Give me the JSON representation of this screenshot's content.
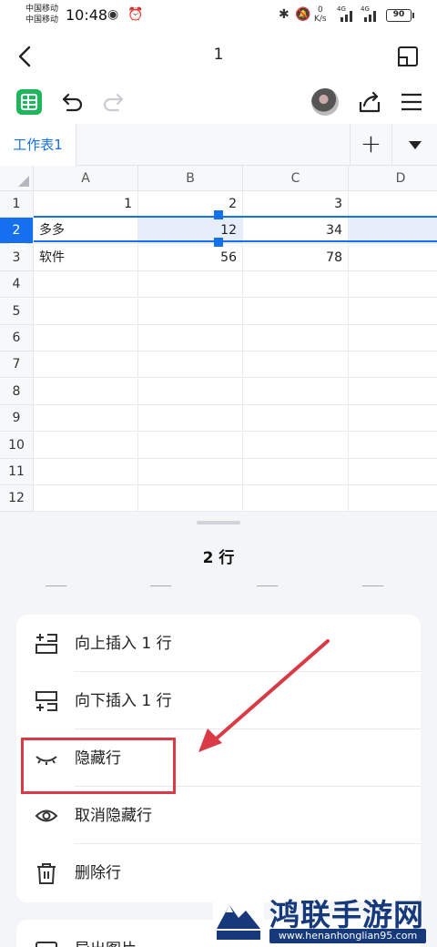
{
  "status_bar": {
    "carrier_line1": "中国移动",
    "carrier_line2": "中国移动",
    "time": "10:48",
    "speed_value": "0",
    "speed_unit": "K/s",
    "signal1_label": "4G",
    "signal2_label": "4G",
    "battery": "90"
  },
  "header": {
    "title": "1"
  },
  "sheet_tabs": {
    "active": "工作表1",
    "add_label": "+"
  },
  "grid": {
    "columns": [
      "A",
      "B",
      "C",
      "D"
    ],
    "rows": [
      {
        "num": "1",
        "cells": [
          "1",
          "2",
          "3",
          ""
        ]
      },
      {
        "num": "2",
        "cells": [
          "多多",
          "12",
          "34",
          ""
        ]
      },
      {
        "num": "3",
        "cells": [
          "软件",
          "56",
          "78",
          ""
        ]
      },
      {
        "num": "4",
        "cells": [
          "",
          "",
          "",
          ""
        ]
      },
      {
        "num": "5",
        "cells": [
          "",
          "",
          "",
          ""
        ]
      },
      {
        "num": "6",
        "cells": [
          "",
          "",
          "",
          ""
        ]
      },
      {
        "num": "7",
        "cells": [
          "",
          "",
          "",
          ""
        ]
      },
      {
        "num": "8",
        "cells": [
          "",
          "",
          "",
          ""
        ]
      },
      {
        "num": "9",
        "cells": [
          "",
          "",
          "",
          ""
        ]
      },
      {
        "num": "10",
        "cells": [
          "",
          "",
          "",
          ""
        ]
      },
      {
        "num": "11",
        "cells": [
          "",
          "",
          "",
          ""
        ]
      },
      {
        "num": "12",
        "cells": [
          "",
          "",
          "",
          ""
        ]
      }
    ],
    "selected_row": "2"
  },
  "panel": {
    "title": "2 行",
    "menu": [
      {
        "label": "向上插入 1 行",
        "icon": "insert-above-icon"
      },
      {
        "label": "向下插入 1 行",
        "icon": "insert-below-icon"
      },
      {
        "label": "隐藏行",
        "icon": "eye-closed-icon"
      },
      {
        "label": "取消隐藏行",
        "icon": "eye-icon"
      },
      {
        "label": "删除行",
        "icon": "trash-icon"
      }
    ],
    "next_group_label": "导出图片"
  },
  "colors": {
    "accent": "#1570ef",
    "sheet_green": "#1fb75b",
    "annotation_red": "#d93a46"
  },
  "watermark": {
    "title": "鸿联手游网",
    "url": "www.henanhonglian95.com"
  }
}
